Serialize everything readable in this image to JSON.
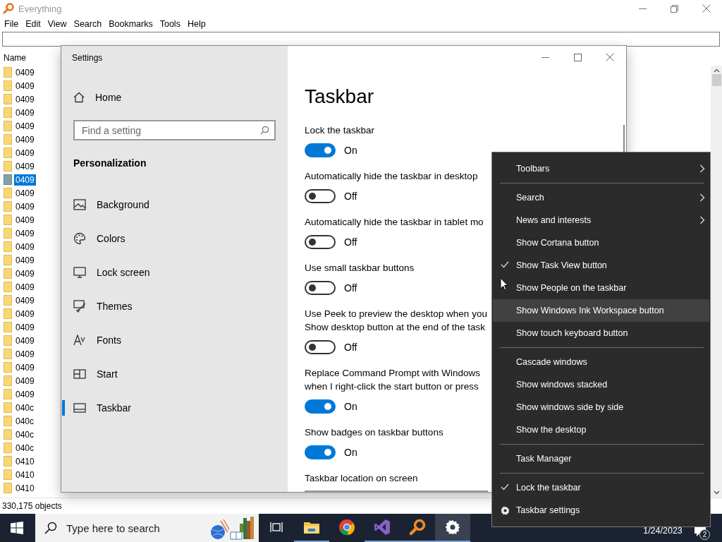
{
  "everything": {
    "title": "Everything",
    "menu": [
      "File",
      "Edit",
      "View",
      "Search",
      "Bookmarks",
      "Tools",
      "Help"
    ],
    "column": "Name",
    "rows": [
      {
        "name": "0409",
        "selected": false
      },
      {
        "name": "0409",
        "selected": false
      },
      {
        "name": "0409",
        "selected": false
      },
      {
        "name": "0409",
        "selected": false
      },
      {
        "name": "0409",
        "selected": false
      },
      {
        "name": "0409",
        "selected": false
      },
      {
        "name": "0409",
        "selected": false
      },
      {
        "name": "0409",
        "selected": false
      },
      {
        "name": "0409",
        "selected": true
      },
      {
        "name": "0409",
        "selected": false
      },
      {
        "name": "0409",
        "selected": false
      },
      {
        "name": "0409",
        "selected": false
      },
      {
        "name": "0409",
        "selected": false
      },
      {
        "name": "0409",
        "selected": false
      },
      {
        "name": "0409",
        "selected": false
      },
      {
        "name": "0409",
        "selected": false
      },
      {
        "name": "0409",
        "selected": false
      },
      {
        "name": "0409",
        "selected": false
      },
      {
        "name": "0409",
        "selected": false
      },
      {
        "name": "0409",
        "selected": false
      },
      {
        "name": "0409",
        "selected": false
      },
      {
        "name": "0409",
        "selected": false
      },
      {
        "name": "0409",
        "selected": false
      },
      {
        "name": "0409",
        "selected": false
      },
      {
        "name": "0409",
        "selected": false
      },
      {
        "name": "040c",
        "selected": false
      },
      {
        "name": "040c",
        "selected": false
      },
      {
        "name": "040c",
        "selected": false
      },
      {
        "name": "040c",
        "selected": false
      },
      {
        "name": "0410",
        "selected": false
      },
      {
        "name": "0410",
        "selected": false
      },
      {
        "name": "0410",
        "selected": false
      }
    ],
    "status": "330,175 objects"
  },
  "settings": {
    "title": "Settings",
    "home": "Home",
    "search": {
      "placeholder": "Find a setting"
    },
    "section": "Personalization",
    "nav": [
      {
        "label": "Background",
        "selected": false
      },
      {
        "label": "Colors",
        "selected": false
      },
      {
        "label": "Lock screen",
        "selected": false
      },
      {
        "label": "Themes",
        "selected": false
      },
      {
        "label": "Fonts",
        "selected": false
      },
      {
        "label": "Start",
        "selected": false
      },
      {
        "label": "Taskbar",
        "selected": true
      }
    ],
    "heading": "Taskbar",
    "options": [
      {
        "kind": "toggle",
        "lines": [
          "Lock the taskbar"
        ],
        "on": true,
        "state": "On"
      },
      {
        "kind": "toggle",
        "lines": [
          "Automatically hide the taskbar in desktop"
        ],
        "on": false,
        "state": "Off"
      },
      {
        "kind": "toggle",
        "lines": [
          "Automatically hide the taskbar in tablet mo"
        ],
        "on": false,
        "state": "Off"
      },
      {
        "kind": "toggle",
        "lines": [
          "Use small taskbar buttons"
        ],
        "on": false,
        "state": "Off"
      },
      {
        "kind": "toggle",
        "lines": [
          "Use Peek to preview the desktop when you",
          "Show desktop button at the end of the task"
        ],
        "on": false,
        "state": "Off"
      },
      {
        "kind": "toggle",
        "lines": [
          "Replace Command Prompt with Windows",
          "when I right-click the start button or press"
        ],
        "on": true,
        "state": "On"
      },
      {
        "kind": "toggle",
        "lines": [
          "Show badges on taskbar buttons"
        ],
        "on": true,
        "state": "On"
      },
      {
        "kind": "dropdown",
        "lines": [
          "Taskbar location on screen"
        ]
      }
    ]
  },
  "context_menu": {
    "items": [
      {
        "kind": "item",
        "label": "Toolbars",
        "submenu": true,
        "checked": false,
        "selected": false
      },
      {
        "kind": "separator"
      },
      {
        "kind": "item",
        "label": "Search",
        "submenu": true,
        "checked": false,
        "selected": false
      },
      {
        "kind": "item",
        "label": "News and interests",
        "submenu": true,
        "checked": false,
        "selected": false
      },
      {
        "kind": "item",
        "label": "Show Cortana button",
        "submenu": false,
        "checked": false,
        "selected": false
      },
      {
        "kind": "item",
        "label": "Show Task View button",
        "submenu": false,
        "checked": true,
        "selected": false
      },
      {
        "kind": "item",
        "label": "Show People on the taskbar",
        "submenu": false,
        "checked": false,
        "selected": false
      },
      {
        "kind": "item",
        "label": "Show Windows Ink Workspace button",
        "submenu": false,
        "checked": false,
        "selected": true
      },
      {
        "kind": "item",
        "label": "Show touch keyboard button",
        "submenu": false,
        "checked": false,
        "selected": false
      },
      {
        "kind": "separator"
      },
      {
        "kind": "item",
        "label": "Cascade windows",
        "submenu": false,
        "checked": false,
        "selected": false
      },
      {
        "kind": "item",
        "label": "Show windows stacked",
        "submenu": false,
        "checked": false,
        "selected": false
      },
      {
        "kind": "item",
        "label": "Show windows side by side",
        "submenu": false,
        "checked": false,
        "selected": false
      },
      {
        "kind": "item",
        "label": "Show the desktop",
        "submenu": false,
        "checked": false,
        "selected": false
      },
      {
        "kind": "separator"
      },
      {
        "kind": "item",
        "label": "Task Manager",
        "submenu": false,
        "checked": false,
        "selected": false
      },
      {
        "kind": "separator"
      },
      {
        "kind": "item",
        "label": "Lock the taskbar",
        "submenu": false,
        "checked": true,
        "selected": false
      },
      {
        "kind": "settings",
        "label": "Taskbar settings",
        "submenu": false,
        "checked": false,
        "selected": false
      }
    ]
  },
  "taskbar": {
    "search": {
      "placeholder": "Type here to search"
    },
    "apps": [
      {
        "running": false,
        "selected": false
      },
      {
        "running": true,
        "selected": false
      },
      {
        "running": false,
        "selected": false
      },
      {
        "running": true,
        "selected": false
      },
      {
        "running": true,
        "selected": false
      },
      {
        "running": true,
        "selected": true
      }
    ],
    "date": "1/24/2023",
    "notifications": "2"
  }
}
